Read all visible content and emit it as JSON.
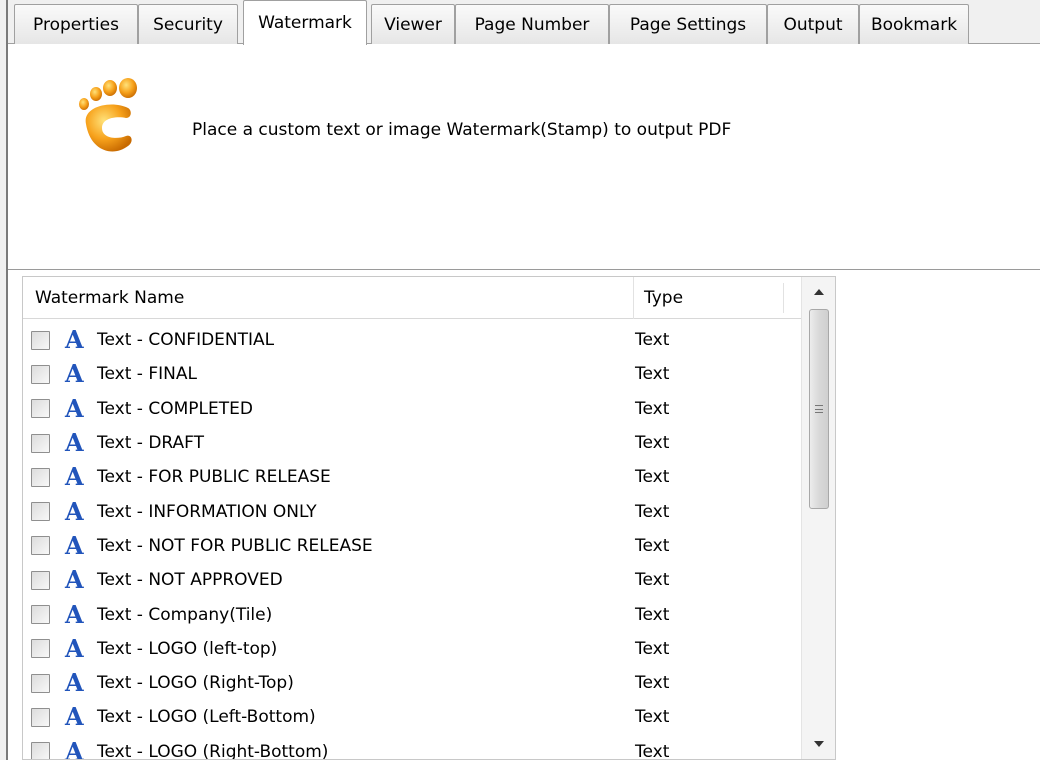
{
  "tabs": [
    {
      "label": "Properties",
      "active": false
    },
    {
      "label": "Security",
      "active": false
    },
    {
      "label": "Watermark",
      "active": true
    },
    {
      "label": "Viewer",
      "active": false
    },
    {
      "label": "Page Number",
      "active": false
    },
    {
      "label": "Page Settings",
      "active": false
    },
    {
      "label": "Output",
      "active": false
    },
    {
      "label": "Bookmark",
      "active": false
    }
  ],
  "header": {
    "logo_icon": "foot-logo-icon",
    "description": "Place a custom text or image Watermark(Stamp) to output PDF"
  },
  "list": {
    "columns": {
      "name": "Watermark Name",
      "type": "Type"
    },
    "row_icon": "letter-a-icon",
    "rows": [
      {
        "name": "Text - CONFIDENTIAL",
        "type": "Text",
        "checked": false
      },
      {
        "name": "Text - FINAL",
        "type": "Text",
        "checked": false
      },
      {
        "name": "Text - COMPLETED",
        "type": "Text",
        "checked": false
      },
      {
        "name": "Text - DRAFT",
        "type": "Text",
        "checked": false
      },
      {
        "name": "Text - FOR PUBLIC RELEASE",
        "type": "Text",
        "checked": false
      },
      {
        "name": "Text - INFORMATION ONLY",
        "type": "Text",
        "checked": false
      },
      {
        "name": "Text - NOT FOR PUBLIC RELEASE",
        "type": "Text",
        "checked": false
      },
      {
        "name": "Text - NOT APPROVED",
        "type": "Text",
        "checked": false
      },
      {
        "name": "Text - Company(Tile)",
        "type": "Text",
        "checked": false
      },
      {
        "name": "Text - LOGO (left-top)",
        "type": "Text",
        "checked": false
      },
      {
        "name": "Text - LOGO (Right-Top)",
        "type": "Text",
        "checked": false
      },
      {
        "name": "Text - LOGO (Left-Bottom)",
        "type": "Text",
        "checked": false
      },
      {
        "name": "Text - LOGO (Right-Bottom)",
        "type": "Text",
        "checked": false
      }
    ]
  },
  "colors": {
    "row_icon": "#2255bb",
    "logo_orange": "#f09010"
  }
}
